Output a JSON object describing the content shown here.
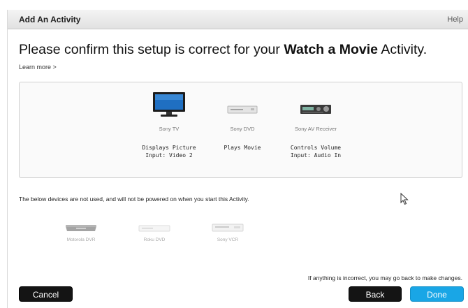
{
  "window": {
    "title": "Add An Activity",
    "help_label": "Help"
  },
  "header": {
    "prefix": "Please confirm this setup is correct for your ",
    "activity": "Watch a Movie",
    "suffix": " Activity.",
    "learn_more": "Learn more >"
  },
  "used_devices": [
    {
      "icon": "tv-icon",
      "name": "Sony TV",
      "role": "Displays Picture",
      "input": "Input: Video 2"
    },
    {
      "icon": "dvd-player-icon",
      "name": "Sony DVD",
      "role": "Plays Movie",
      "input": ""
    },
    {
      "icon": "av-receiver-icon",
      "name": "Sony AV Receiver",
      "role": "Controls Volume",
      "input": "Input: Audio In"
    }
  ],
  "unused_note": "The below devices are not used, and will not be powered on when you start this Activity.",
  "unused_devices": [
    {
      "icon": "dvr-icon",
      "name": "Motorola DVR"
    },
    {
      "icon": "dvd-player-icon",
      "name": "Roku DVD"
    },
    {
      "icon": "vcr-icon",
      "name": "Sony VCR"
    }
  ],
  "footer": {
    "note": "If anything is incorrect, you may go back to make changes.",
    "cancel_label": "Cancel",
    "back_label": "Back",
    "done_label": "Done"
  },
  "colors": {
    "done_button": "#19a6e6",
    "dark_button": "#141414"
  }
}
